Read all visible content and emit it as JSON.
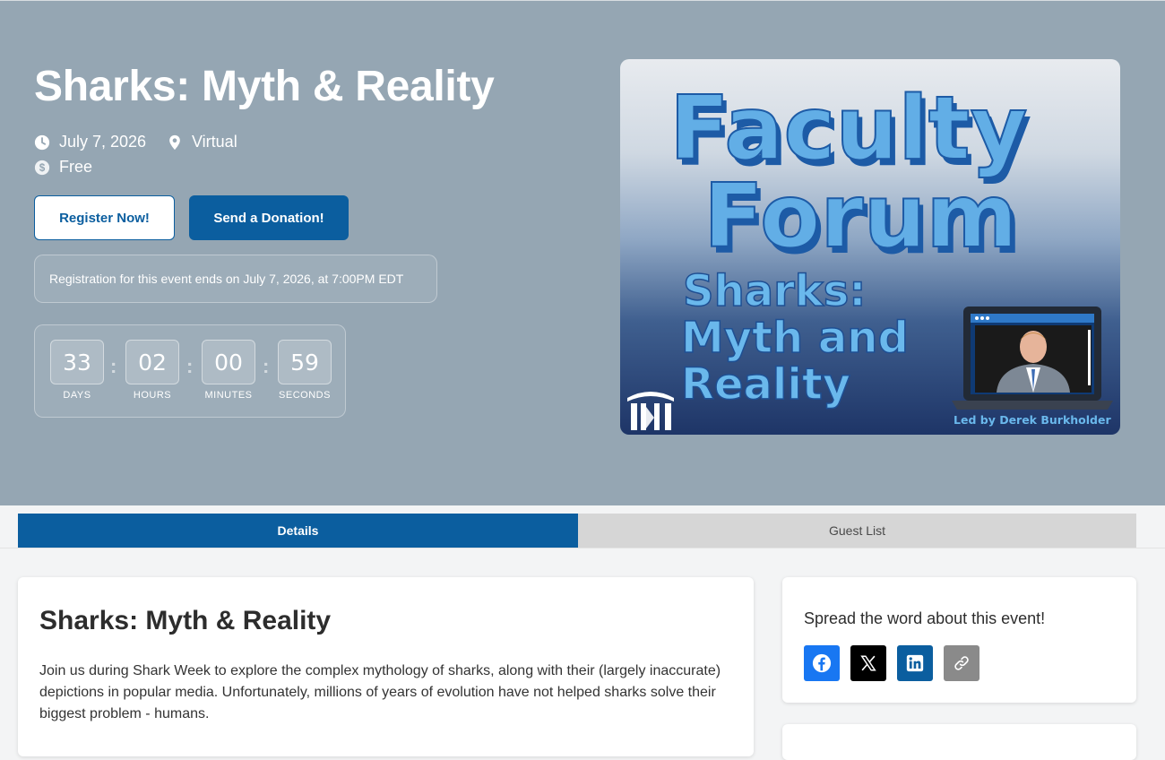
{
  "hero": {
    "title": "Sharks: Myth & Reality",
    "date": "July 7, 2026",
    "location": "Virtual",
    "price": "Free",
    "register_label": "Register Now!",
    "donate_label": "Send a Donation!",
    "registration_note": "Registration for this event ends on July 7, 2026, at 7:00PM EDT",
    "countdown": [
      {
        "value": "33",
        "label": "DAYS"
      },
      {
        "value": "02",
        "label": "HOURS"
      },
      {
        "value": "00",
        "label": "MINUTES"
      },
      {
        "value": "59",
        "label": "SECONDS"
      }
    ],
    "separator": ":"
  },
  "promo_image": {
    "line1": "Faculty",
    "line2": "Forum",
    "subtitle_lines": [
      "Sharks:",
      "Myth and",
      "Reality"
    ],
    "credit": "Led by Derek Burkholder",
    "icons": [
      "campus-logo-icon",
      "laptop-icon",
      "presenter-photo"
    ]
  },
  "tabs": [
    {
      "label": "Details",
      "active": true
    },
    {
      "label": "Guest List",
      "active": false
    }
  ],
  "details": {
    "heading": "Sharks: Myth & Reality",
    "description": "Join us during Shark Week to explore the complex mythology of sharks, along with their (largely inaccurate) depictions in popular media. Unfortunately, millions of years of evolution have not helped sharks solve their biggest problem - humans."
  },
  "share": {
    "title": "Spread the word about this event!",
    "buttons": [
      {
        "icon": "facebook-icon",
        "color": "#1877f2"
      },
      {
        "icon": "x-icon",
        "color": "#000000"
      },
      {
        "icon": "linkedin-icon",
        "color": "#0b5e9f"
      },
      {
        "icon": "link-icon",
        "color": "#8a8a8a"
      }
    ]
  },
  "colors": {
    "hero_background": "#95a6b3",
    "brand_blue": "#0b5e9f",
    "tab_inactive": "#d6d6d6"
  }
}
